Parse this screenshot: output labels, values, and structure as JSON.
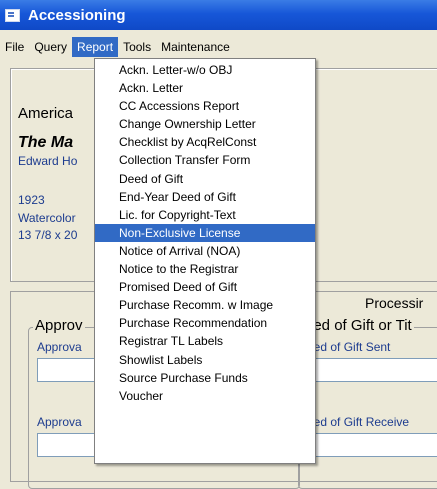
{
  "window": {
    "title": "Accessioning"
  },
  "menubar": {
    "items": [
      "File",
      "Query",
      "Report",
      "Tools",
      "Maintenance"
    ],
    "active": "Report"
  },
  "record": {
    "line1": "America",
    "line2": "The Ma",
    "line3": "Edward Ho",
    "line4": "1923",
    "line5": "Watercolor",
    "line6": "13 7/8 x 20"
  },
  "tabs": {
    "processing": "Processir"
  },
  "approval": {
    "group_label": "Approv",
    "field1_label": "Approva",
    "field2_label": "Approva"
  },
  "deed": {
    "group_label": "eed of Gift or Tit",
    "sent_label": "eed of Gift Sent",
    "received_label": "eed of Gift Receive"
  },
  "report_menu": {
    "items": [
      "Ackn. Letter-w/o OBJ",
      "Ackn. Letter",
      "CC Accessions Report",
      "Change Ownership Letter",
      "Checklist by AcqRelConst",
      "Collection Transfer Form",
      "Deed of Gift",
      "End-Year Deed of Gift",
      "Lic. for Copyright-Text",
      "Non-Exclusive License",
      "Notice of Arrival (NOA)",
      "Notice to the Registrar",
      "Promised Deed of Gift",
      "Purchase Recomm. w Image",
      "Purchase Recommendation",
      "Registrar  TL Labels",
      "Showlist Labels",
      "Source Purchase Funds",
      "Voucher"
    ],
    "highlighted": "Non-Exclusive License"
  }
}
